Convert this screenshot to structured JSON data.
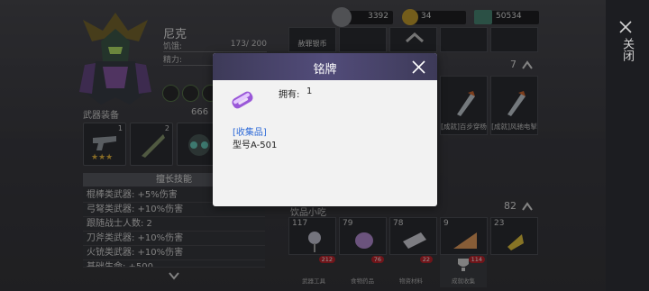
{
  "hero": {
    "name": "尼克",
    "hunger_label": "饥饿:",
    "hunger_value": "173/ 200",
    "energy_label": "精力:"
  },
  "equipment": {
    "title": "武器装备",
    "power": "666",
    "slot1_badge": "1",
    "slot1_stars": "★★★",
    "slot2_badge": "2"
  },
  "skills": {
    "title": "擅长技能",
    "items": [
      "棍棒类武器: +5%伤害",
      "弓弩类武器: +10%伤害",
      "跟随战士人数: 2",
      "刀斧类武器: +10%伤害",
      "火铳类武器: +10%伤害",
      "基础生命: +500"
    ]
  },
  "resources": {
    "silver": "3392",
    "gold": "34",
    "money": "50534"
  },
  "inventory": {
    "top_slot_label": "赦罪银币",
    "section1_count": "7",
    "section1_items": [
      {
        "caption": "[成就]百步穿杨"
      },
      {
        "caption": "[成就]风驰电掣"
      }
    ],
    "section2_title": "饮品小吃",
    "section2_count": "82",
    "section2_counts": [
      "117",
      "79",
      "78",
      "9",
      "23"
    ],
    "tabs": [
      {
        "label": "武器工具",
        "badge": "212"
      },
      {
        "label": "食物药品",
        "badge": "76"
      },
      {
        "label": "物资材料",
        "badge": "22"
      },
      {
        "label": "成就收集",
        "badge": "114"
      }
    ]
  },
  "rail": {
    "close_label": "关闭"
  },
  "modal": {
    "title": "铭牌",
    "owned_label": "拥有:",
    "owned_value": "1",
    "category": "[收集品]",
    "description": "型号A-501"
  },
  "colors": {
    "accent_blue": "#2f6bd8",
    "header_purple": "#524c7a",
    "badge_red": "#c0242c"
  }
}
